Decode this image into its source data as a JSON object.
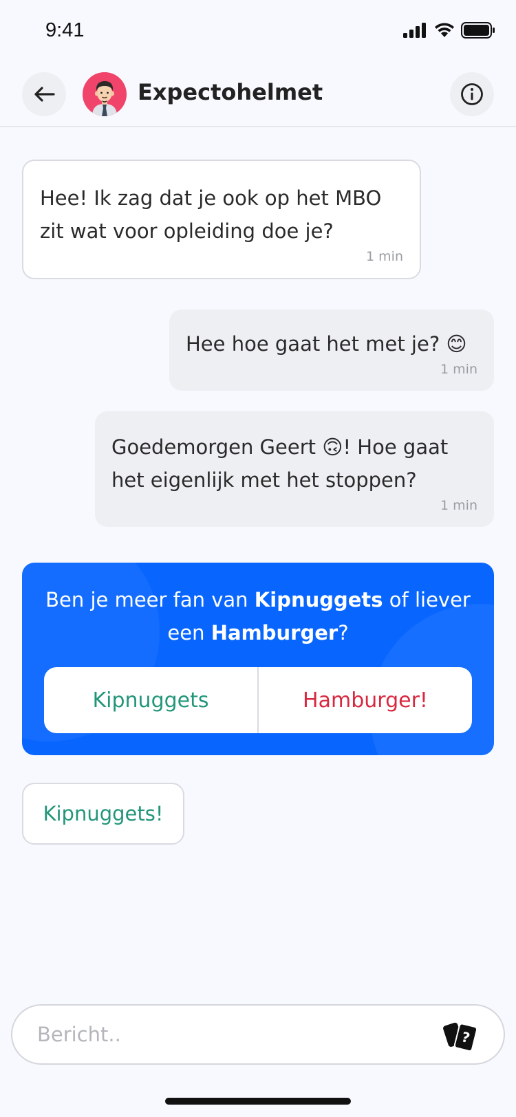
{
  "status": {
    "time": "9:41"
  },
  "header": {
    "title": "Expectohelmet"
  },
  "messages": [
    {
      "side": "in",
      "text": "Hee! Ik zag dat je ook op het MBO zit wat voor opleiding doe je?",
      "time": "1 min"
    },
    {
      "side": "out",
      "text": "Hee hoe gaat het met je? 😊",
      "time": "1 min"
    },
    {
      "side": "out",
      "text": "Goedemorgen Geert 🙃! Hoe gaat het eigenlijk met het stoppen?",
      "time": "1 min"
    }
  ],
  "poll": {
    "q_before": "Ben je meer fan van ",
    "q_bold1": "Kipnuggets",
    "q_middle": " of liever een ",
    "q_bold2": "Hamburger",
    "q_after": "?",
    "option_a": "Kipnuggets",
    "option_b": "Hamburger!",
    "option_a_color": "#23967a",
    "option_b_color": "#d8283f",
    "background": "#0866ff"
  },
  "answer": {
    "text": "Kipnuggets!"
  },
  "composer": {
    "placeholder": "Bericht.."
  },
  "icons": {
    "back": "arrow-left-icon",
    "info": "info-circle-icon",
    "cards": "question-cards-icon"
  }
}
